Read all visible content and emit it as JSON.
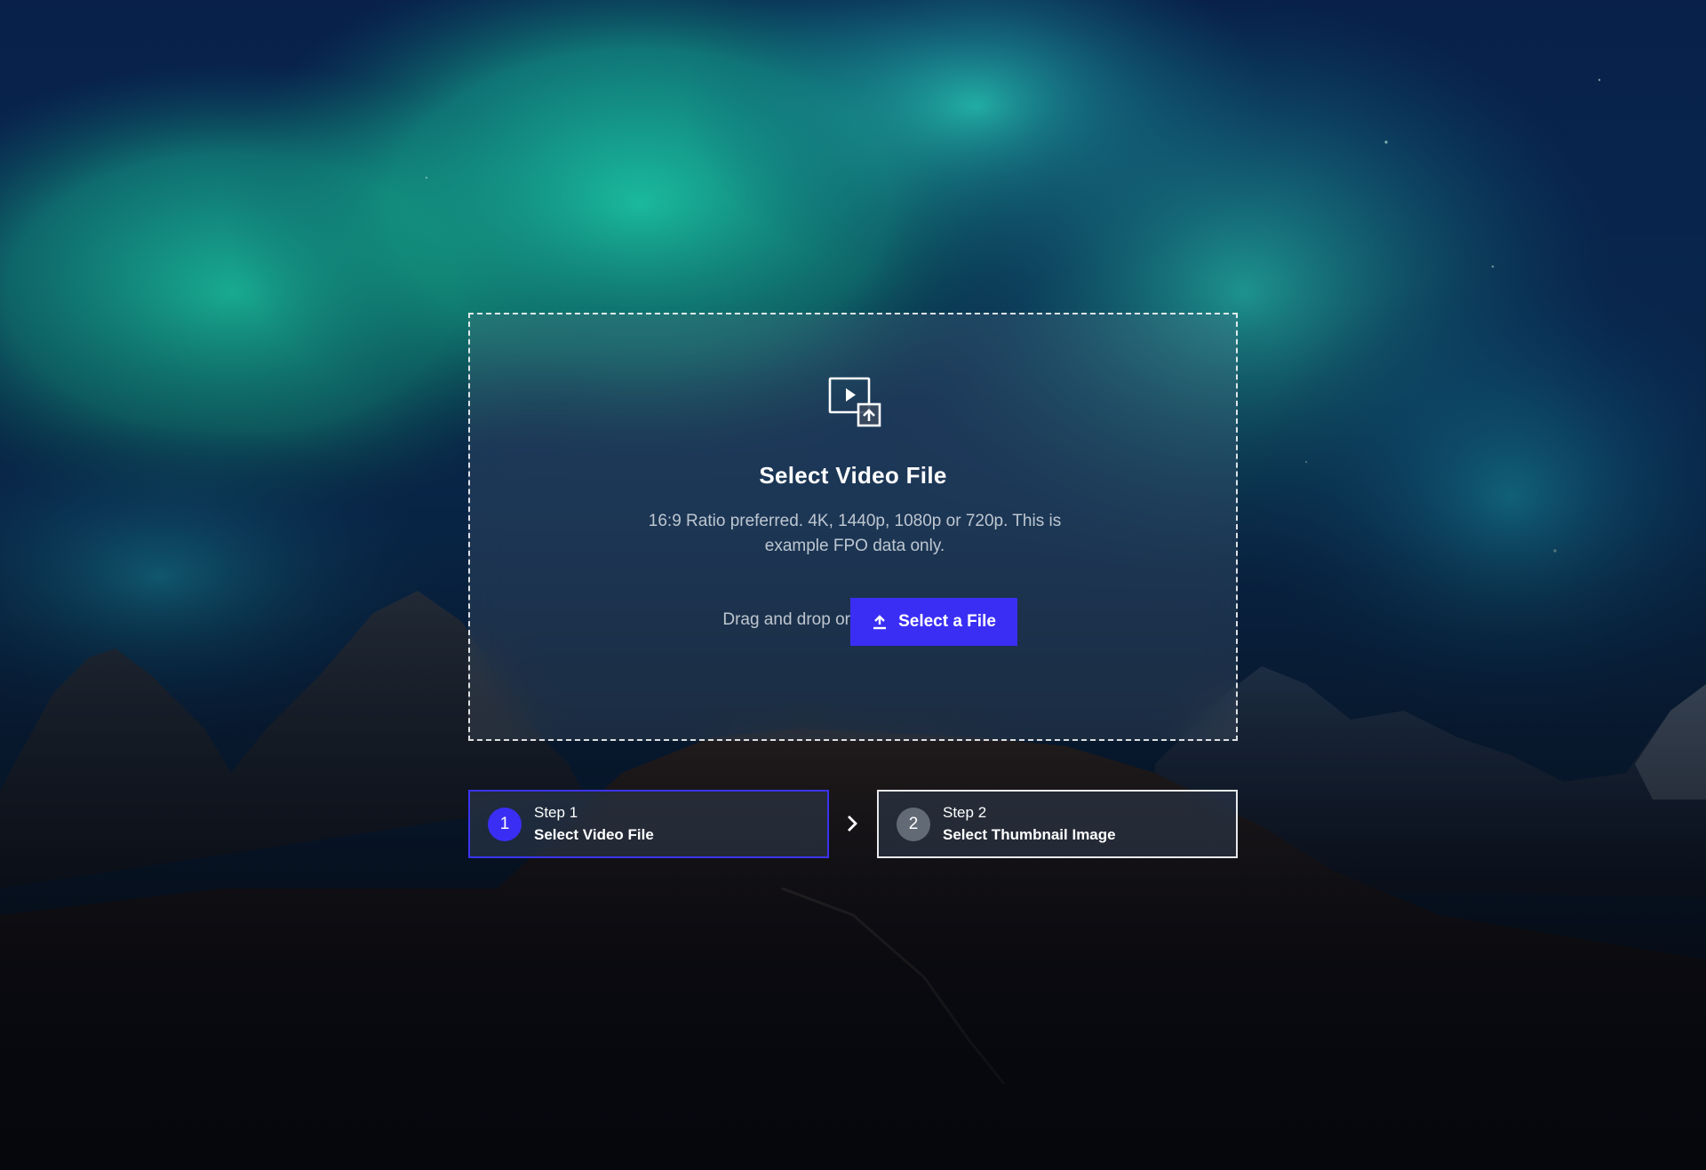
{
  "upload": {
    "icon": "video-upload-icon",
    "title": "Select Video File",
    "description": "16:9 Ratio preferred. 4K, 1440p, 1080p or 720p. This is example FPO data only.",
    "drag_text": "Drag and drop or",
    "button_icon": "upload-arrow-icon",
    "button_label": "Select a File"
  },
  "steps": [
    {
      "number": "1",
      "label": "Step 1",
      "title": "Select Video File",
      "active": true
    },
    {
      "number": "2",
      "label": "Step 2",
      "title": "Select Thumbnail Image",
      "active": false
    }
  ],
  "step_separator_icon": "chevron-right-icon",
  "colors": {
    "accent": "#3a2ef5",
    "aurora": "#18d7b4",
    "sky": "#0e2a5c"
  }
}
